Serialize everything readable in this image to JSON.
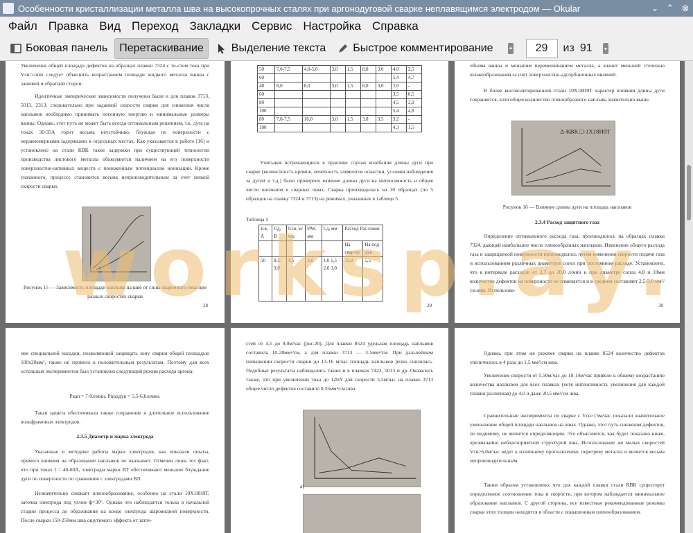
{
  "window": {
    "title": "Особенности кристаллизации металла шва на высокопрочных сталях при аргонодуговой сварке неплавящимся электродом — Okular"
  },
  "menu": [
    "Файл",
    "Правка",
    "Вид",
    "Переход",
    "Закладки",
    "Сервис",
    "Настройка",
    "Справка"
  ],
  "toolbar": {
    "sidebar": "Боковая панель",
    "browse": "Перетаскивание",
    "text_select": "Выделение текста",
    "quick_annotate": "Быстрое комментирование",
    "page_current": "29",
    "of_label": "из",
    "page_total": "91"
  },
  "watermark": "worksp.ay.ru",
  "pages": {
    "p1": {
      "para1": "Увеличение общей площади дефектов на образцах плавки 7324 с то-стом тока при Vсв=const следует объяснить возрастанием площади жидкого металла ванны с зашевой и обратной сторон.",
      "para2": "Идентичные эмпирические зависимости получены были и для плавок 3713, 5013, 2313. следовательно при заданной скорости сварки для снижения числа наплывов необходимо принимать погонную энергию и минимальные размеры ванны. Однако, этот путь не может быть всегда оптимальным решением, т.к. дуга на токах 30-35А горит весьма неустойчиво, блуждая по поверхности с неравномерными задержками в отдельных местах. Как указывается в работе [16] и установлено на стали КВК такие задержки при существующей технологии производства листового металла объясняются наличием на его поверхности поверхностно-активных веществ с пониженным потенциалом ионизации. Кроме указанного, процессе становится весьма непроизводительным за счет низкой скорости сварки.",
      "caption": "Рисунок 15 — Зависимость площади наплыва на шве от силы сварочного тока при разных скоростях сварки",
      "page_num": "28"
    },
    "p2": {
      "table1": [
        [
          "50",
          "7,0-7,5",
          "4,0-5,0",
          "3,0",
          "1,5",
          "8,0",
          "3,0",
          "4,0",
          "2,5"
        ],
        [
          "60",
          "",
          "",
          "",
          "",
          "",
          "",
          "5,4",
          "4,7"
        ],
        [
          "40",
          "8,0",
          "8,0",
          "3,0",
          "1,5",
          "8,0",
          "3,0",
          "2,0",
          "-"
        ],
        [
          "60",
          "",
          "",
          "",
          "",
          "",
          "",
          "3,5",
          "0,5"
        ],
        [
          "80",
          "",
          "",
          "",
          "",
          "",
          "",
          "4,5",
          "2,9"
        ],
        [
          "100",
          "",
          "",
          "",
          "",
          "",
          "",
          "5,4",
          "4,8"
        ],
        [
          "80",
          "7,0-7,5",
          "16,0",
          "3,0",
          "1,5",
          "3,0",
          "3,5",
          "3,2",
          "-"
        ],
        [
          "100",
          "",
          "",
          "",
          "",
          "",
          "",
          "4,3",
          "1,5"
        ]
      ],
      "para1": "Учитывая встречающиеся в практике случаи колебания длины дуги при сварке (колинстность кромок, нечетность элементов оснастки, условия наблюдения за дугой и т.д.) было проверено влияние длины дуги на интенсивность и общее число наплывов в сварных швах. Сварка производилась на 10 образцах (по 5 образцов на плавку 7324 и 3713) на режимах, указанных в таблице 5.",
      "table_label": "Таблица 5",
      "table2_head": [
        "Iсв, А",
        "Uд, В",
        "Uсв, м/час",
        "ØW, мм",
        "Lд, мм",
        "Расход Рar л/мин"
      ],
      "table2_sub": [
        "На свар-ку",
        "На под-дув"
      ],
      "table2_row": [
        "50",
        "8,5-9,0",
        "4,5",
        "3,0",
        "1,0 1,5 2,0 3,0",
        "12,0",
        "5,5"
      ],
      "page_num": "29"
    },
    "p3": {
      "para_top": "объема ванны и меньшим перемешиванием металла, а значит меньшей степенью шлакообразования за счет поверхностно-адсорбционных явлений.",
      "para1": "В более высоколегированной стали 10Х18Н9Т характер влияния длины дуги сохраняется, хотя общее количество пленообразного наплыва значительно выше.",
      "legend": "Δ-КВК  □-1Х18Н9Т",
      "caption": "Рисунок 16 — Влияние длины дуги на площадь наплывов",
      "heading": "2.3.4 Расход защитного газа",
      "para2": "Определение оптимального расхода газа, производилось на образцах плавки 7324, дающей наибольшее число пленообразных наплывов. Изменение общего расхода газа и защищаемой поверхности производилось путем изменения скорости подачи газа и использованием различных диаметров сопел при постоянном расходе. Установлено, что в интервале расходов от 2,7 до 20,0 л/мин и при диаметре сопла 4,8 и 18мм количество дефектов на поверхности не изменяется и в среднем составляет 2,5-3,0 мм²/см.шва. Использова-",
      "page_num": "30"
    },
    "p4": {
      "para1": "ние специальной насадки, позволяющей защищать зону сварки общей площадью 100x20мм², также не привело к положительным результатам. Поэтому для всех остальных экспериментов был установлен следующий режим расхода аргона:",
      "formula": "Pкап = 7-9л/мин. Pподдув = 5,5-6,0л/мин.",
      "para2": "Такая защита обеспечивала также сохранение и длительное использование вольфрамовых электродов.",
      "heading": "2.3.5 Диаметр и марка электрода",
      "para3": "Указанные в методике работы марки электродов, как показали опыты, прямого влияния на образование наплывов не оказывает. Отмечен лишь тот факт, что при токах I = 40-60А, электроды марки ВТ обеспечивают меньшее блуждание дуги по поверхности по сравнению с электродами ВЛ.",
      "para4": "Незначительно снижает пленообразование, особенно на стали 10Х18Н9Т, заточка электрода под углом ф=30°. Однако это наблюдается только в начальной стадии процесса до образования на конце электрода шаровидной поверхности. После сварки 150-250мм шва ощутимого эффекта от заточ-"
    },
    "p5": {
      "para1": "стей от 4,5 до 8,0м/час (рис.20). Для плавки 8524 удельная площадь наплывов составила 10-28мм²/см, а для плавки 3713 — 3-5мм²/см. При дальнейшем повышении скорости сварки до 13-16 м/час площадь наплывов резко снизилась. Подобные результаты наблюдались также и в плавках 7423, 5013 и др. Оказалось также, что при увеличении тока до 120А для скорости 5,5м/час на плавке 3713 общее число дефектов составило 0,35мм²/см шва.",
      "fig_label": "а)"
    },
    "p6": {
      "para1": "Однако, при этом же режиме сварки на плавке 8524 количество дефектов увеличилось в 4 раза до 1,5 мм²/см шва.",
      "para2": "Увеличение скорости от 5,50м/час до 10-14м/час привело к общему возрастанию количества наплывов для всех плавках (хотя интенсивность увеличения для каждой плавки различная) до 4,0 и даже 20,5 мм²/см шва.",
      "para3": "Сравнительные эксперименты по сварке с Vсв>15м/час показали значительное уменьшение общей площади наплывов на швах. Однако, этот путь снижения дефектов, по видимому, не является определяющим. Это объясняется, как будет показано ниже, чрезвычайно неблагоприятной структурой шва. Использование же малых скоростей Vсв>6,0м/час ведет к излишнему проплавлению, перегреву металла и является весьма непроизводительным.",
      "para4": "Таким образом установлено, что для каждой плавки стали КВК существует определенное соотношение тока и скорости, при котором наблюдается минимальное образование наплывов. С другой стороны, все известные рекомендованные режимы сварки этих толщин находятся в области с повышенным пленообразованием."
    }
  }
}
